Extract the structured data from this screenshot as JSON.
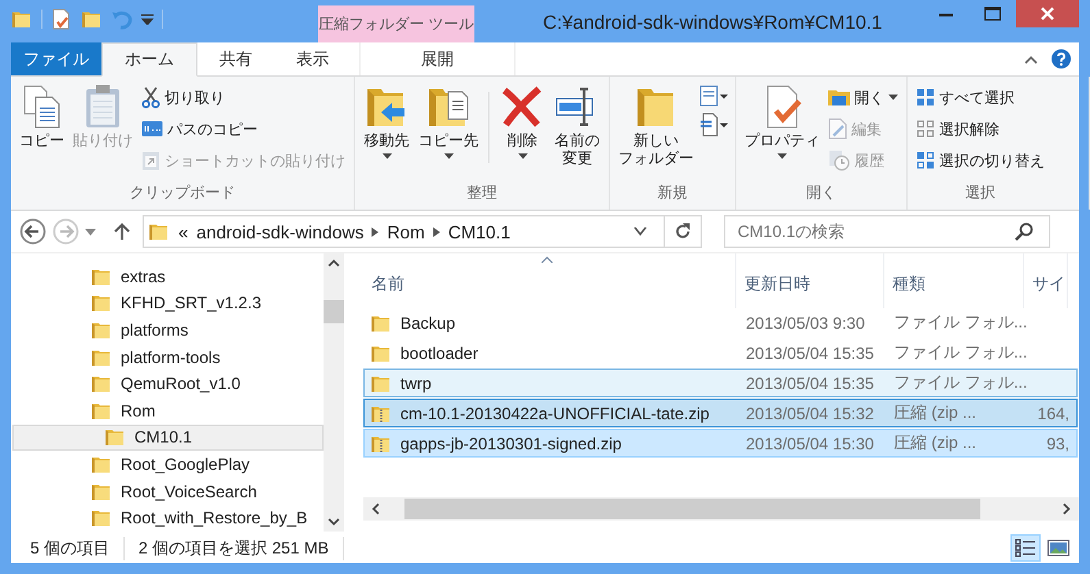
{
  "window": {
    "title": "C:¥android-sdk-windows¥Rom¥CM10.1"
  },
  "context_tab": {
    "label": "圧縮フォルダー ツール"
  },
  "tabs": [
    {
      "label": "ファイル",
      "kind": "file",
      "selected": false
    },
    {
      "label": "ホーム",
      "kind": "normal",
      "selected": true
    },
    {
      "label": "共有",
      "kind": "normal",
      "selected": false
    },
    {
      "label": "表示",
      "kind": "normal",
      "selected": false
    },
    {
      "label": "展開",
      "kind": "context",
      "selected": false
    }
  ],
  "ribbon": {
    "clipboard": {
      "label": "クリップボード",
      "copy": {
        "label": "コピー",
        "disabled": false
      },
      "paste": {
        "label": "貼り付け",
        "disabled": true
      },
      "cut": {
        "label": "切り取り"
      },
      "copy_path": {
        "label": "パスのコピー"
      },
      "paste_shortcut": {
        "label": "ショートカットの貼り付け",
        "disabled": true
      }
    },
    "organize": {
      "label": "整理",
      "move_to": {
        "label": "移動先"
      },
      "copy_to": {
        "label": "コピー先"
      },
      "delete": {
        "label": "削除"
      },
      "rename": {
        "lines": [
          "名前の",
          "変更"
        ]
      }
    },
    "new": {
      "label": "新規",
      "new_folder": {
        "lines": [
          "新しい",
          "フォルダー"
        ]
      }
    },
    "open": {
      "label": "開く",
      "properties": {
        "label": "プロパティ"
      },
      "open": {
        "label": "開く"
      },
      "edit": {
        "label": "編集",
        "disabled": true
      },
      "history": {
        "label": "履歴",
        "disabled": true
      }
    },
    "select": {
      "label": "選択",
      "select_all": {
        "label": "すべて選択"
      },
      "select_none": {
        "label": "選択解除"
      },
      "invert": {
        "label": "選択の切り替え"
      }
    }
  },
  "address": {
    "overflow": "«",
    "crumbs": [
      "android-sdk-windows",
      "Rom",
      "CM10.1"
    ]
  },
  "search": {
    "placeholder": "CM10.1の検索"
  },
  "tree": [
    {
      "label": "extras",
      "selected": false
    },
    {
      "label": "KFHD_SRT_v1.2.3",
      "selected": false
    },
    {
      "label": "platforms",
      "selected": false
    },
    {
      "label": "platform-tools",
      "selected": false
    },
    {
      "label": "QemuRoot_v1.0",
      "selected": false
    },
    {
      "label": "Rom",
      "selected": false,
      "children": [
        {
          "label": "CM10.1",
          "selected": true
        }
      ]
    },
    {
      "label": "Root_GooglePlay",
      "selected": false
    },
    {
      "label": "Root_VoiceSearch",
      "selected": false
    },
    {
      "label": "Root_with_Restore_by_B",
      "selected": false
    }
  ],
  "columns": [
    "名前",
    "更新日時",
    "種類",
    "サイ"
  ],
  "files": [
    {
      "kind": "folder",
      "name": "Backup",
      "modified": "2013/05/03 9:30",
      "type": "ファイル フォル...",
      "selected": false,
      "hovered": false
    },
    {
      "kind": "folder",
      "name": "bootloader",
      "modified": "2013/05/04 15:35",
      "type": "ファイル フォル...",
      "selected": false,
      "hovered": false
    },
    {
      "kind": "folder",
      "name": "twrp",
      "modified": "2013/05/04 15:35",
      "type": "ファイル フォル...",
      "selected": false,
      "hovered": true
    },
    {
      "kind": "zip",
      "name": "cm-10.1-20130422a-UNOFFICIAL-tate.zip",
      "modified": "2013/05/04 15:32",
      "type": "圧縮 (zip ...",
      "size": "164,",
      "selected": true,
      "hovered": true
    },
    {
      "kind": "zip",
      "name": "gapps-jb-20130301-signed.zip",
      "modified": "2013/05/04 15:30",
      "type": "圧縮 (zip ...",
      "size": "93,",
      "selected": true,
      "hovered": false
    }
  ],
  "status_bar": {
    "item_count": "5 個の項目",
    "selection": "2 個の項目を選択 251 MB"
  },
  "views": [
    {
      "selected": true
    },
    {
      "selected": false
    }
  ]
}
